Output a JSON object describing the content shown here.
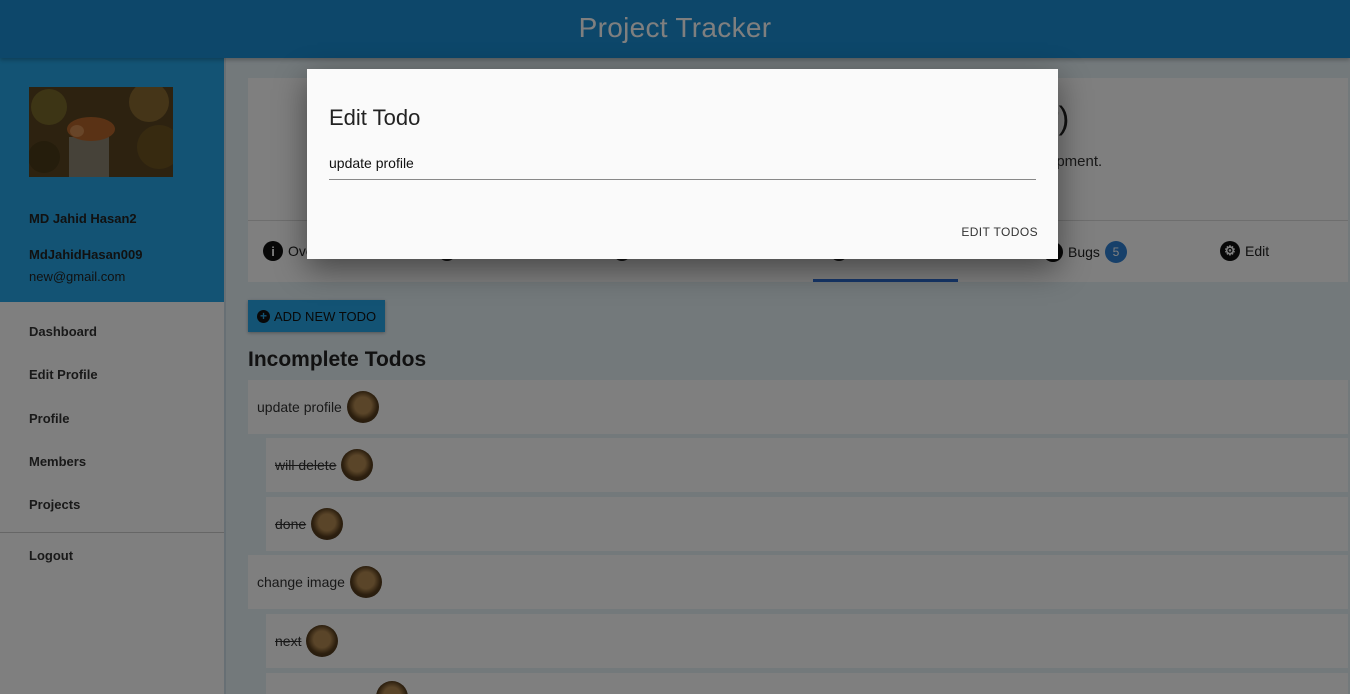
{
  "app": {
    "title": "Project Tracker"
  },
  "sidebar": {
    "name": "MD Jahid Hasan2",
    "username": "MdJahidHasan009",
    "email": "new@gmail.com",
    "items": [
      {
        "label": "Dashboard"
      },
      {
        "label": "Edit Profile"
      },
      {
        "label": "Profile"
      },
      {
        "label": "Members"
      },
      {
        "label": "Projects"
      }
    ],
    "logout": "Logout"
  },
  "project": {
    "title_fragment": "r)",
    "desc_fragment": "opment."
  },
  "tabs": {
    "overview_fragment": "Ove",
    "bugs_label": "Bugs",
    "bugs_count": "5",
    "edit_label": "Edit"
  },
  "todos": {
    "add_button": "ADD NEW TODO",
    "section_title": "Incomplete Todos",
    "items": [
      {
        "text": "update profile",
        "done": false
      },
      {
        "text": "will delete",
        "done": true
      },
      {
        "text": "done",
        "done": true
      },
      {
        "text": "change image",
        "done": false
      },
      {
        "text": "next",
        "done": true
      }
    ]
  },
  "dialog": {
    "title": "Edit Todo",
    "input_value": "update profile",
    "action": "EDIT TODOS"
  },
  "colors": {
    "appbar": "#1a8fd4",
    "profile_card": "#26a7e8",
    "badge": "#2f80d4",
    "tab_underline": "#2f6fd4"
  }
}
